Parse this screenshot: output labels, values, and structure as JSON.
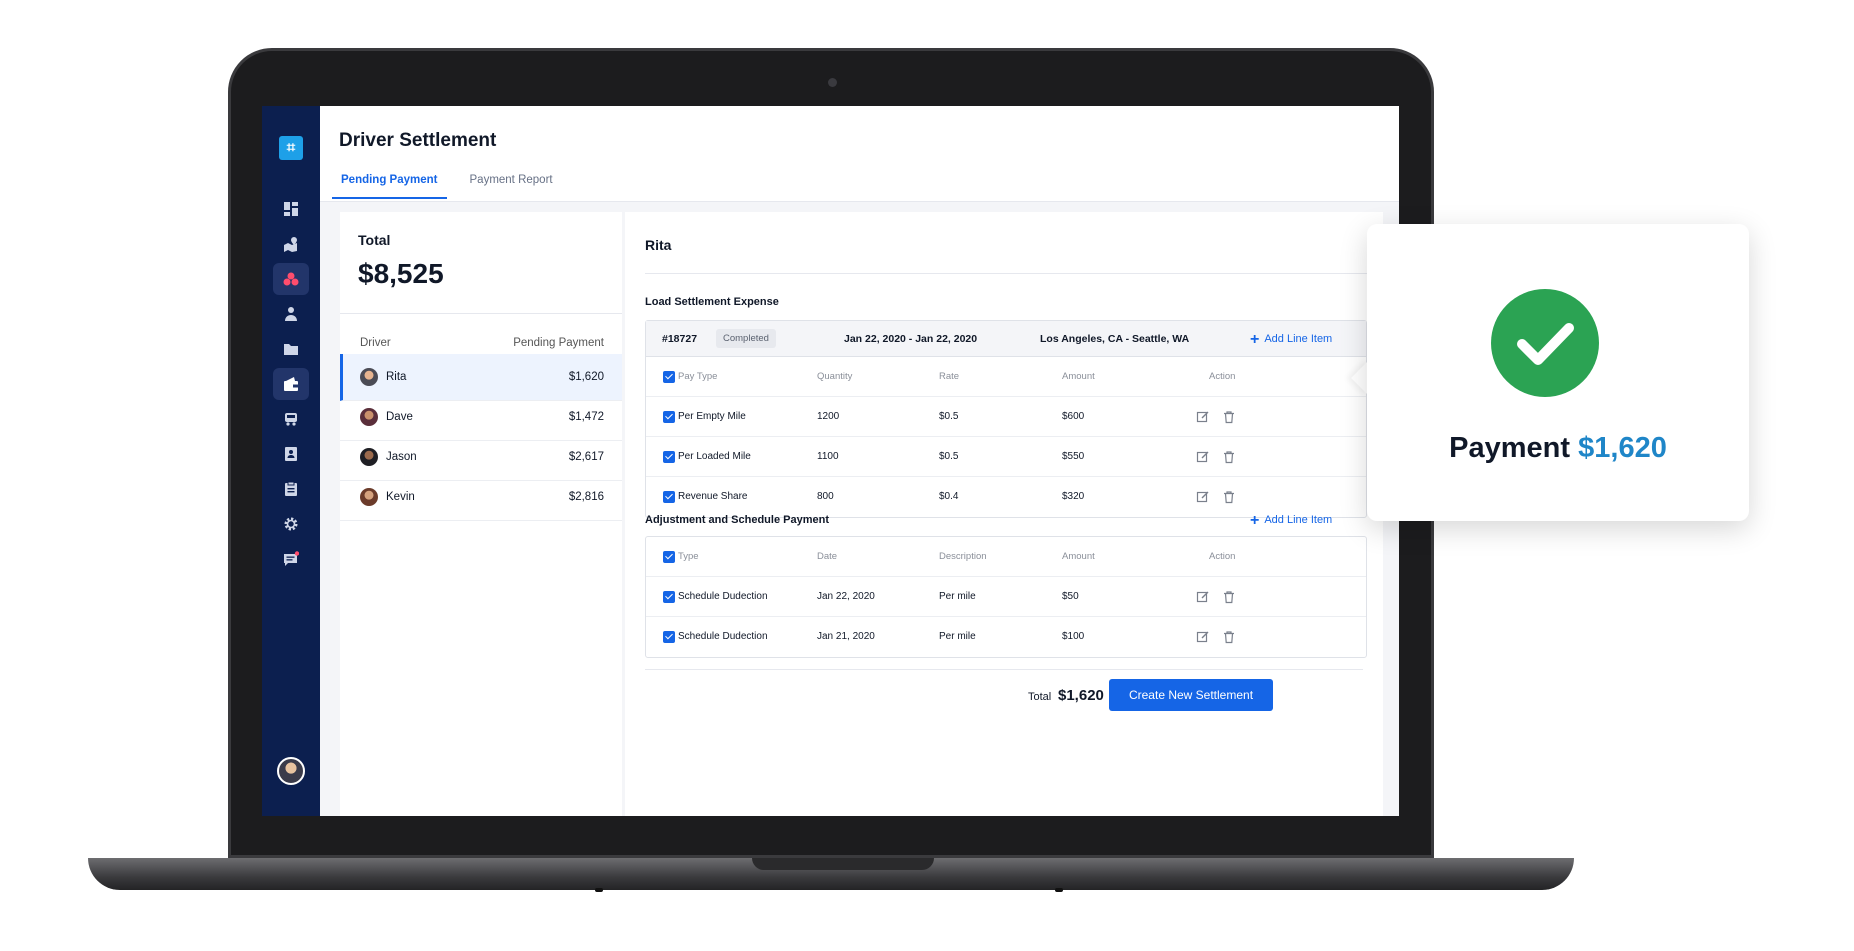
{
  "app": {
    "page_title": "Driver Settlement"
  },
  "tabs": [
    {
      "label": "Pending Payment",
      "active": true
    },
    {
      "label": "Payment Report",
      "active": false
    }
  ],
  "sidebar": {
    "logo_icon": "app-logo-icon",
    "items": [
      {
        "icon": "dashboard-icon"
      },
      {
        "icon": "map-icon"
      },
      {
        "icon": "drivers-icon",
        "active": true
      },
      {
        "icon": "dispatcher-icon"
      },
      {
        "icon": "folder-icon"
      },
      {
        "icon": "wallet-icon",
        "active": true
      },
      {
        "icon": "truck-icon"
      },
      {
        "icon": "contacts-icon"
      },
      {
        "icon": "clipboard-icon"
      },
      {
        "icon": "gear-icon"
      },
      {
        "icon": "messages-icon"
      }
    ]
  },
  "summary": {
    "total_label": "Total",
    "total_value": "$8,525"
  },
  "driver_list": {
    "columns": {
      "driver": "Driver",
      "pending": "Pending Payment"
    },
    "rows": [
      {
        "name": "Rita",
        "amount": "$1,620",
        "selected": true
      },
      {
        "name": "Dave",
        "amount": "$1,472"
      },
      {
        "name": "Jason",
        "amount": "$2,617"
      },
      {
        "name": "Kevin",
        "amount": "$2,816"
      }
    ]
  },
  "detail": {
    "driver_name": "Rita",
    "load_section": {
      "title": "Load Settlement Expense",
      "add_label": "Add Line Item",
      "load": {
        "id": "#18727",
        "status": "Completed",
        "date_range": "Jan 22, 2020 - Jan 22, 2020",
        "route": "Los Angeles, CA - Seattle, WA"
      },
      "columns": {
        "pay_type": "Pay Type",
        "quantity": "Quantity",
        "rate": "Rate",
        "amount": "Amount",
        "action": "Action"
      },
      "rows": [
        {
          "pay_type": "Per Empty Mile",
          "quantity": "1200",
          "rate": "$0.5",
          "amount": "$600"
        },
        {
          "pay_type": "Per Loaded Mile",
          "quantity": "1100",
          "rate": "$0.5",
          "amount": "$550"
        },
        {
          "pay_type": "Revenue Share",
          "quantity": "800",
          "rate": "$0.4",
          "amount": "$320"
        }
      ]
    },
    "adjust_section": {
      "title": "Adjustment and Schedule Payment",
      "add_label": "Add Line Item",
      "columns": {
        "type": "Type",
        "date": "Date",
        "description": "Description",
        "amount": "Amount",
        "action": "Action"
      },
      "rows": [
        {
          "type": "Schedule Dudection",
          "date": "Jan 22, 2020",
          "description": "Per mile",
          "amount": "$50"
        },
        {
          "type": "Schedule Dudection",
          "date": "Jan 21, 2020",
          "description": "Per mile",
          "amount": "$100"
        }
      ]
    },
    "footer": {
      "total_label": "Total",
      "total_value": "$1,620",
      "create_label": "Create New Settlement"
    }
  },
  "popup": {
    "label": "Payment",
    "amount": "$1,620"
  },
  "colors": {
    "primary": "#1565e6",
    "sidebar": "#0c1f4f",
    "success": "#2ba353",
    "popup_amount": "#1f86c8"
  }
}
